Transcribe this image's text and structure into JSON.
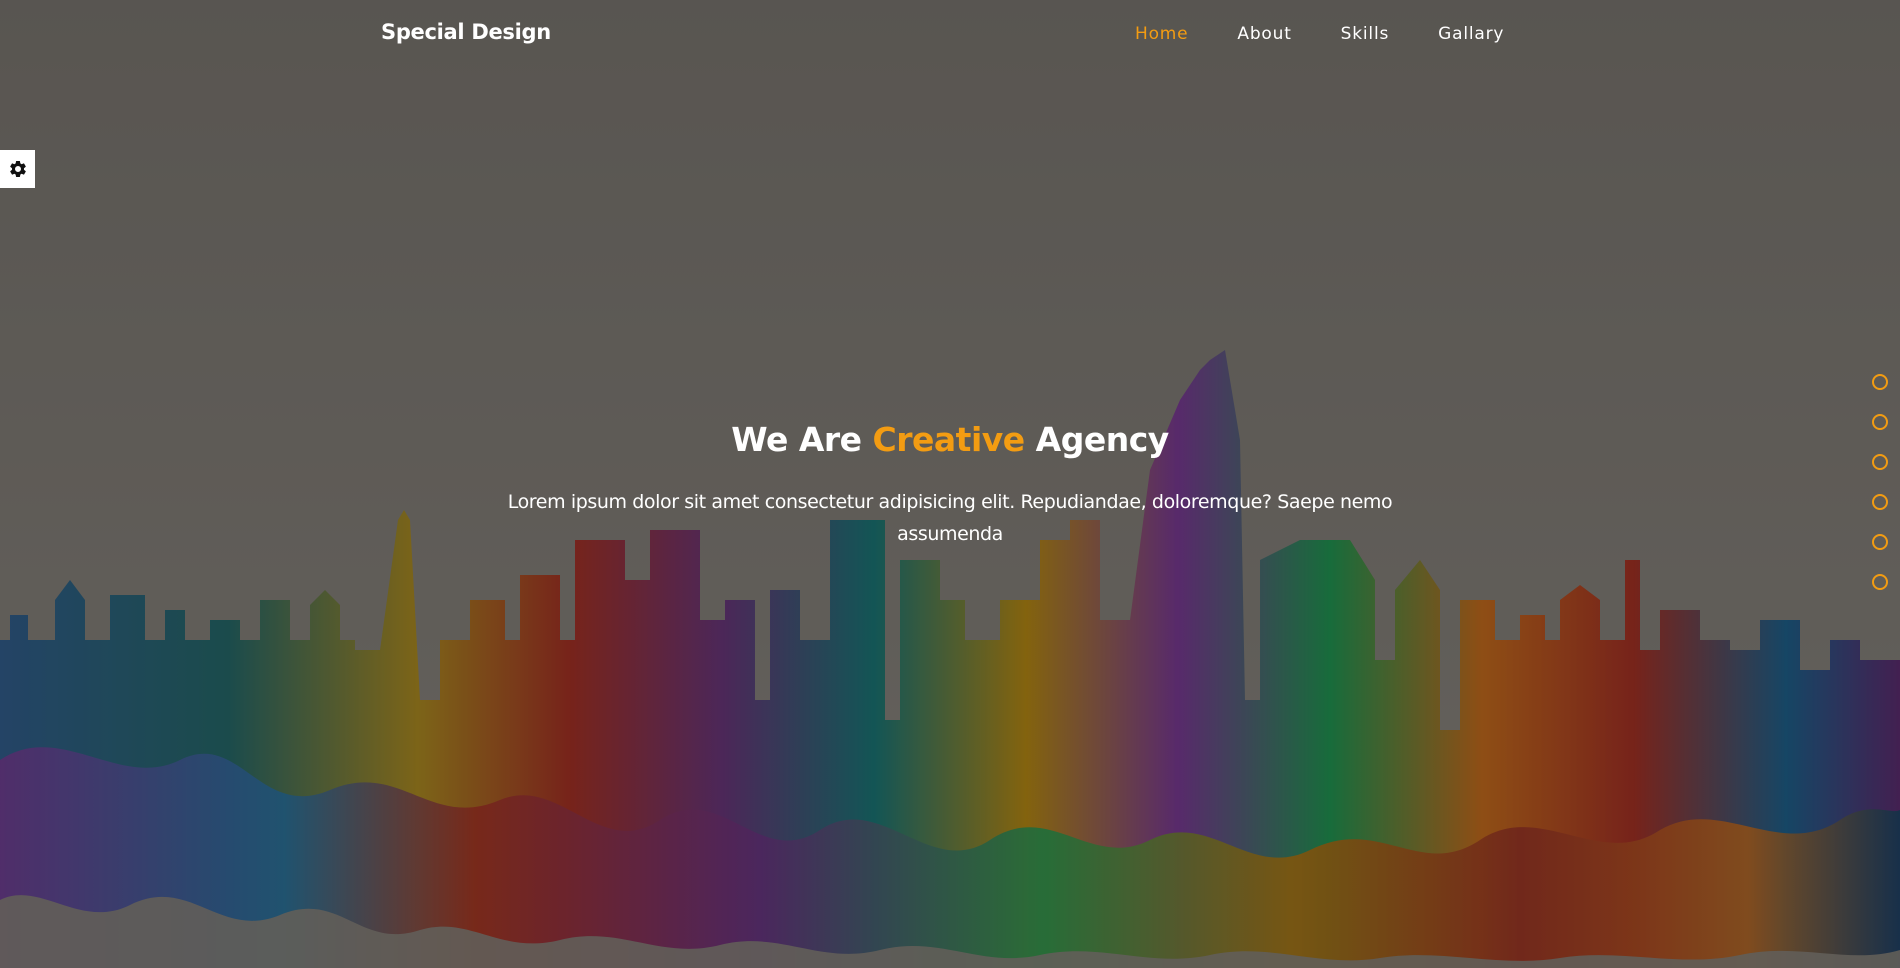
{
  "header": {
    "logo": "Special Design",
    "nav": [
      {
        "label": "Home",
        "active": true
      },
      {
        "label": "About",
        "active": false
      },
      {
        "label": "Skills",
        "active": false
      },
      {
        "label": "Gallary",
        "active": false
      }
    ]
  },
  "settings": {
    "icon": "gear-icon"
  },
  "intro": {
    "title_part1": "We Are",
    "title_accent": "Creative",
    "title_part2": "Agency",
    "paragraph": "Lorem ipsum dolor sit amet consectetur adipisicing elit. Repudiandae, doloremque? Saepe nemo assumenda"
  },
  "bullets_count": 6,
  "colors": {
    "accent": "#f39c12",
    "text": "#ffffff",
    "settings_bg": "#ffffff"
  }
}
